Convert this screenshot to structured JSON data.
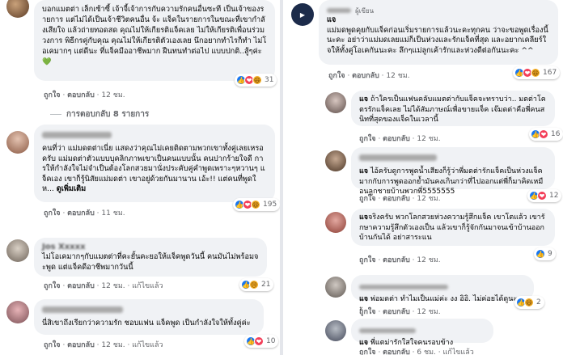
{
  "left": {
    "c1": {
      "text": "บอกแมตต่า เล็กเซ้าซี้ เจ้าจี้เจ้าการกับความรักคนอื่นซะที เป็นเจ้าของรายการ แต่ไม่ได้เป็นเจ้าชีวิตคนอื่น จ้ะ แจ็คในรายการในขณะที่เขากำลังเสียใจ แล้วถ่ายทอดสด คุณไม่ให้เกียรติแจ็คเลย ไม่ให้เกียรติเพื่อนร่วมวงการ พิธีกรคู่กับคุณ คุณไม่ให้เกียรติตัวเองเลย นึกอยากทำไรก็ทำ ไม่โอเคมากๆ แต่ดีนะ ที่แจ็คมีออาชีพมาก ฝืนทนทำต่อไป แบบปกติ..สู้ๆค่ะ💚",
      "like": "ถูกใจ",
      "reply": "ตอบกลับ",
      "time": "12 ชม.",
      "reactions": "31"
    },
    "c1_replies": "การตอบกลับ 8 รายการ",
    "c2": {
      "text": "คนที่ว่า แม่มดตต่าเนี่ย แสดงว่าคุณไม่เคยติดตามพวกเขาทั้งคู่เลยเหรอครับ แม่มดต่าตัวแบบบุคลิกภาพเขาเป็นคนแบบนั้น คนปากร้ายใจดี การให้กำลังใจไม่จำเป็นต้องโลกสวยมานั่งประคับคู่คำพูดเพราะๆหวานๆ แจ็คเอง เขาก็รู้นิสัยแม่มดต่า เขาอยู่ด้วยกันมานาน เอ้ะ!! แต่คนที่พูดให...",
      "seemore": "ดูเพิ่มเติม",
      "like": "ถูกใจ",
      "reply": "ตอบกลับ",
      "time": "11 ชม.",
      "reactions": "195"
    },
    "c3": {
      "name": "Jos Xxxxx",
      "text": "ไม่โอเคมากๆกับแมตต่าที่คะยั้นคะยอให้แจ็คพูดวันนี้ คนมันไม่พร้อมจะพูด แต่แจ็คดีอาชีพมากวันนี้",
      "like": "ถูกใจ",
      "reply": "ตอบกลับ",
      "time": "12 ชม.",
      "edited": "แก้ไขแล้ว",
      "reactions": "21"
    },
    "c4": {
      "text": "นี่สิเขาถึงเรียกว่าความรัก ชอบแฟน แจ็คพูด เป็นกำลังใจให้ทั้งคู่ค่ะ",
      "like": "ถูกใจ",
      "reply": "ตอบกลับ",
      "time": "12 ชม.",
      "edited": "แก้ไขแล้ว",
      "reactions": "10"
    }
  },
  "right": {
    "top": {
      "badge": "ผู้เขียน",
      "tag": "แจ",
      "text": "แม่มดพูดคุยกับแจ็คก่อนเริ่มรายการแล้วนะคะทุกคน ว่าจะขอพูดเรื่องนี้นะคะ อย่าว่าแม่มดเลยแม่ก็เป็นห่วงและรักแจ็คที่สุด และอยากเคลียร์ใจให้ทั้งคู่โอเคกันนะคะ ลึกๆแม่ลูกเค้ารักและห่วงดีต่อกันนะคะ ^^",
      "like": "ถูกใจ",
      "reply": "ตอบกลับ",
      "time": "12 ชม.",
      "reactions": "167"
    },
    "r1": {
      "tag": "แจ",
      "text": "ถ้าใครเป็นแฟนคลับแมตต่ากับแจ็คจะทราบว่า.. มดต่าโคตรรักแจ็คเลย ไม่ได้สัมภาษณ์เพื่อขายแจ็ค เจ๊มดต่าคือพี่คนสนิทที่สุดของแจ็คในเวลานี้",
      "like": "ถูกใจ",
      "reply": "ตอบกลับ",
      "time": "12 ชม.",
      "reactions": "16"
    },
    "r2": {
      "tag": "แจ",
      "text": "ไอ้ครับดูการพูดน้ำเสียงก็รู้ว่าพี่มดต่ารักแจ็คเป็นห่วงแจ็คมากกับการพูดออกย้ำมันคงเกินกว่าที่ไปออกแต่พี่ก็มาคิดเหมือนลูกชายบ้านพวกพี่5555555",
      "like": "ถูกใจ",
      "reply": "ตอบกลับ",
      "time": "12 ชม.",
      "reactions": "12"
    },
    "r3": {
      "tag": "แจ",
      "text": "จริงครับ พวกโลกสวยห่วงความรู้สึกแจ็ค เขาโตแล้ว เขารักษาความรู้สึกตัวเองเป็น แล้วเขาก็รู้จักกันมาจนเข้าบ้านออกบ้านกันได้ อย่าสาระแน",
      "like": "ถูกใจ",
      "reply": "ตอบกลับ",
      "time": "12 ชม.",
      "reactions": "9"
    },
    "r4": {
      "tag": "แจ",
      "text": "พ่อมดต่า ทำไมเป็นแม่ค่ะ งง อิอิ. ไม่ค่อยได้ดูนะคะ",
      "like": "ถูกใจ",
      "reply": "ตอบกลับ",
      "time": "12 ชม.",
      "reactions": "2"
    },
    "r5": {
      "tag": "แจ",
      "text": "พี่แตม่ารักใสใจคนรอบข้าง",
      "like": "ถูกใจ",
      "reply": "ตอบกลับ",
      "time": "6 ชม.",
      "edited": "แก้ไขแล้ว"
    }
  },
  "colors": {
    "accent": "#1877f2",
    "bubble": "#f0f2f5",
    "muted": "#65676b"
  }
}
